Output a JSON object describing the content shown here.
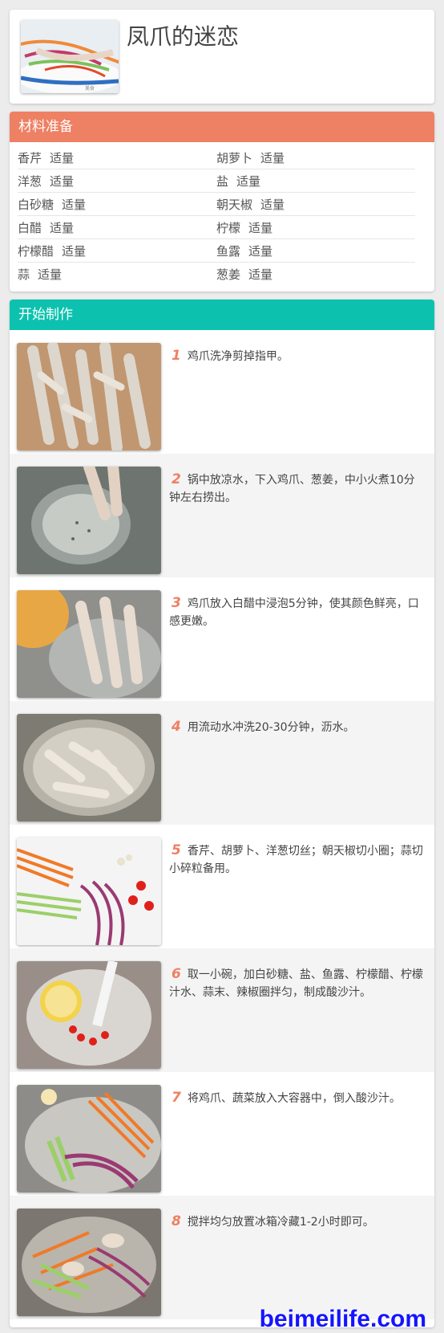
{
  "recipe": {
    "title": "凤爪的迷恋"
  },
  "ingredients": {
    "heading": "材料准备",
    "rows": [
      [
        {
          "name": "香芹",
          "amount": "适量"
        },
        {
          "name": "胡萝卜",
          "amount": "适量"
        }
      ],
      [
        {
          "name": "洋葱",
          "amount": "适量"
        },
        {
          "name": "盐",
          "amount": "适量"
        }
      ],
      [
        {
          "name": "白砂糖",
          "amount": "适量"
        },
        {
          "name": "朝天椒",
          "amount": "适量"
        }
      ],
      [
        {
          "name": "白醋",
          "amount": "适量"
        },
        {
          "name": "柠檬",
          "amount": "适量"
        }
      ],
      [
        {
          "name": "柠檬醋",
          "amount": "适量"
        },
        {
          "name": "鱼露",
          "amount": "适量"
        }
      ],
      [
        {
          "name": "蒜",
          "amount": "适量"
        },
        {
          "name": "葱姜",
          "amount": "适量"
        }
      ]
    ]
  },
  "steps": {
    "heading": "开始制作",
    "items": [
      {
        "num": "1",
        "text": "鸡爪洗净剪掉指甲。"
      },
      {
        "num": "2",
        "text": "锅中放凉水，下入鸡爪、葱姜，中小火煮10分钟左右捞出。"
      },
      {
        "num": "3",
        "text": "鸡爪放入白醋中浸泡5分钟，使其颜色鲜亮，口感更嫩。"
      },
      {
        "num": "4",
        "text": "用流动水冲洗20-30分钟，沥水。"
      },
      {
        "num": "5",
        "text": "香芹、胡萝卜、洋葱切丝；朝天椒切小圈；蒜切小碎粒备用。"
      },
      {
        "num": "6",
        "text": "取一小碗，加白砂糖、盐、鱼露、柠檬醋、柠檬汁水、蒜末、辣椒圈拌匀，制成酸沙汁。"
      },
      {
        "num": "7",
        "text": "将鸡爪、蔬菜放入大容器中，倒入酸沙汁。"
      },
      {
        "num": "8",
        "text": "搅拌均匀放置冰箱冷藏1-2小时即可。"
      }
    ]
  },
  "watermark": "beimeilife.com",
  "colors": {
    "ingredients_header": "#ee8063",
    "steps_header": "#0cc2af",
    "step_number": "#ee8063",
    "watermark": "#1515ff"
  }
}
